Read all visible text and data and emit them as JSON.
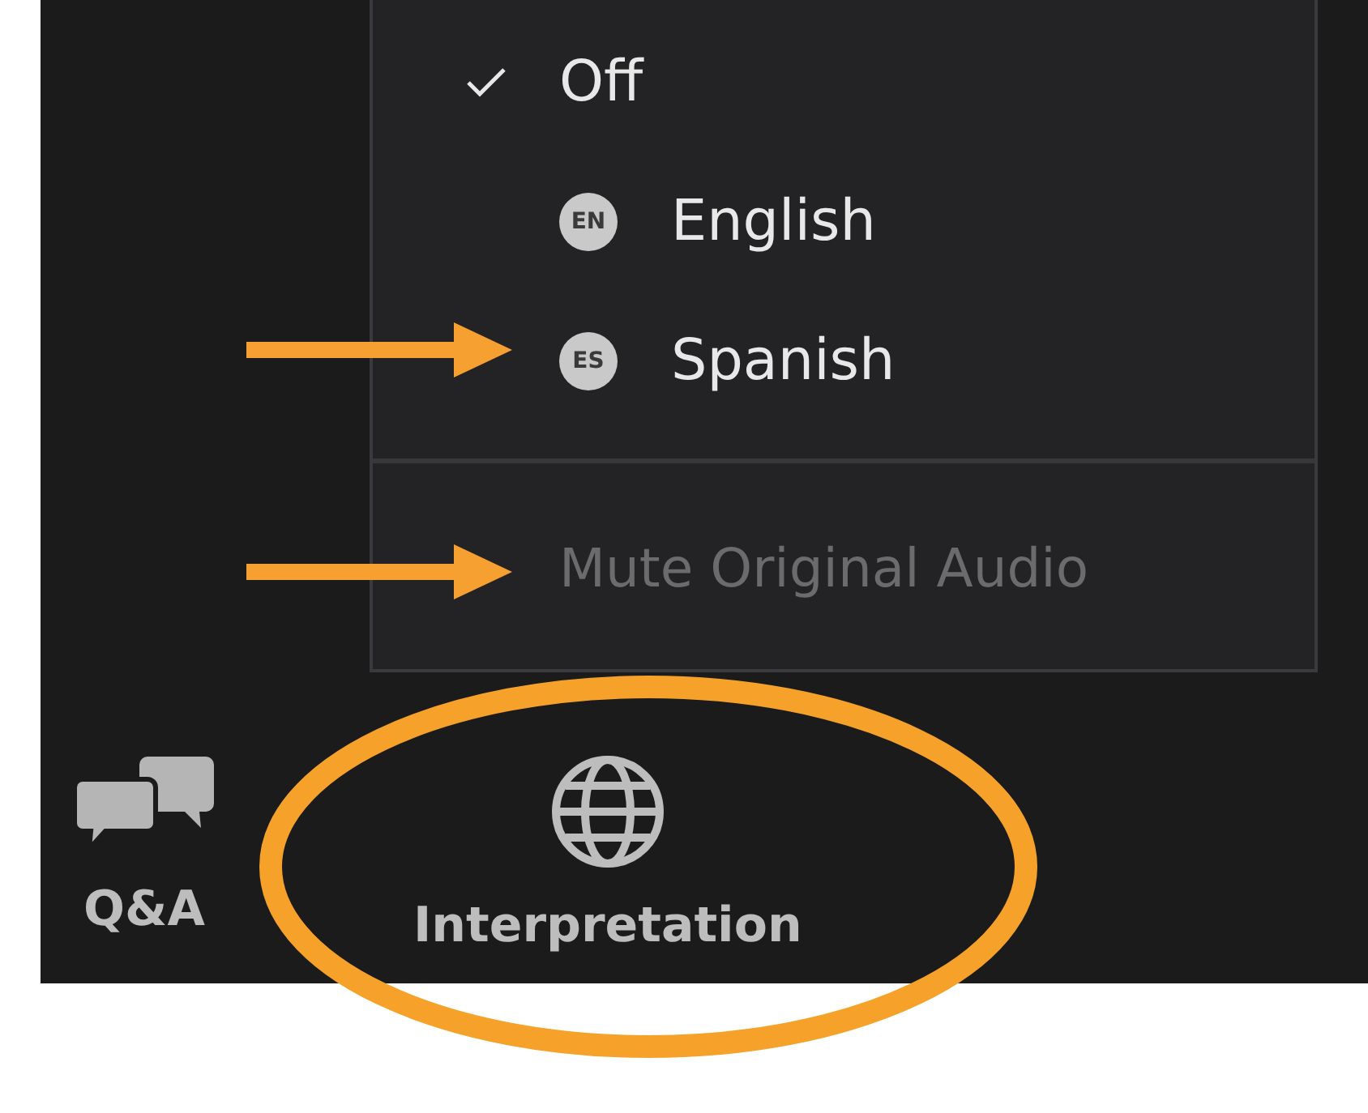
{
  "menu": {
    "items": [
      {
        "kind": "check",
        "label": "Off",
        "checked": true
      },
      {
        "kind": "language",
        "badge": "EN",
        "label": "English",
        "checked": false
      },
      {
        "kind": "language",
        "badge": "ES",
        "label": "Spanish",
        "checked": false
      }
    ],
    "mute_original_audio": {
      "label": "Mute Original Audio",
      "disabled": true
    }
  },
  "toolbar": {
    "buttons": [
      {
        "kind": "qa",
        "label": "Q&A"
      },
      {
        "kind": "globe",
        "label": "Interpretation"
      }
    ]
  },
  "annotations": [
    {
      "kind": "arrow"
    },
    {
      "kind": "arrow"
    },
    {
      "kind": "ellipse"
    }
  ]
}
